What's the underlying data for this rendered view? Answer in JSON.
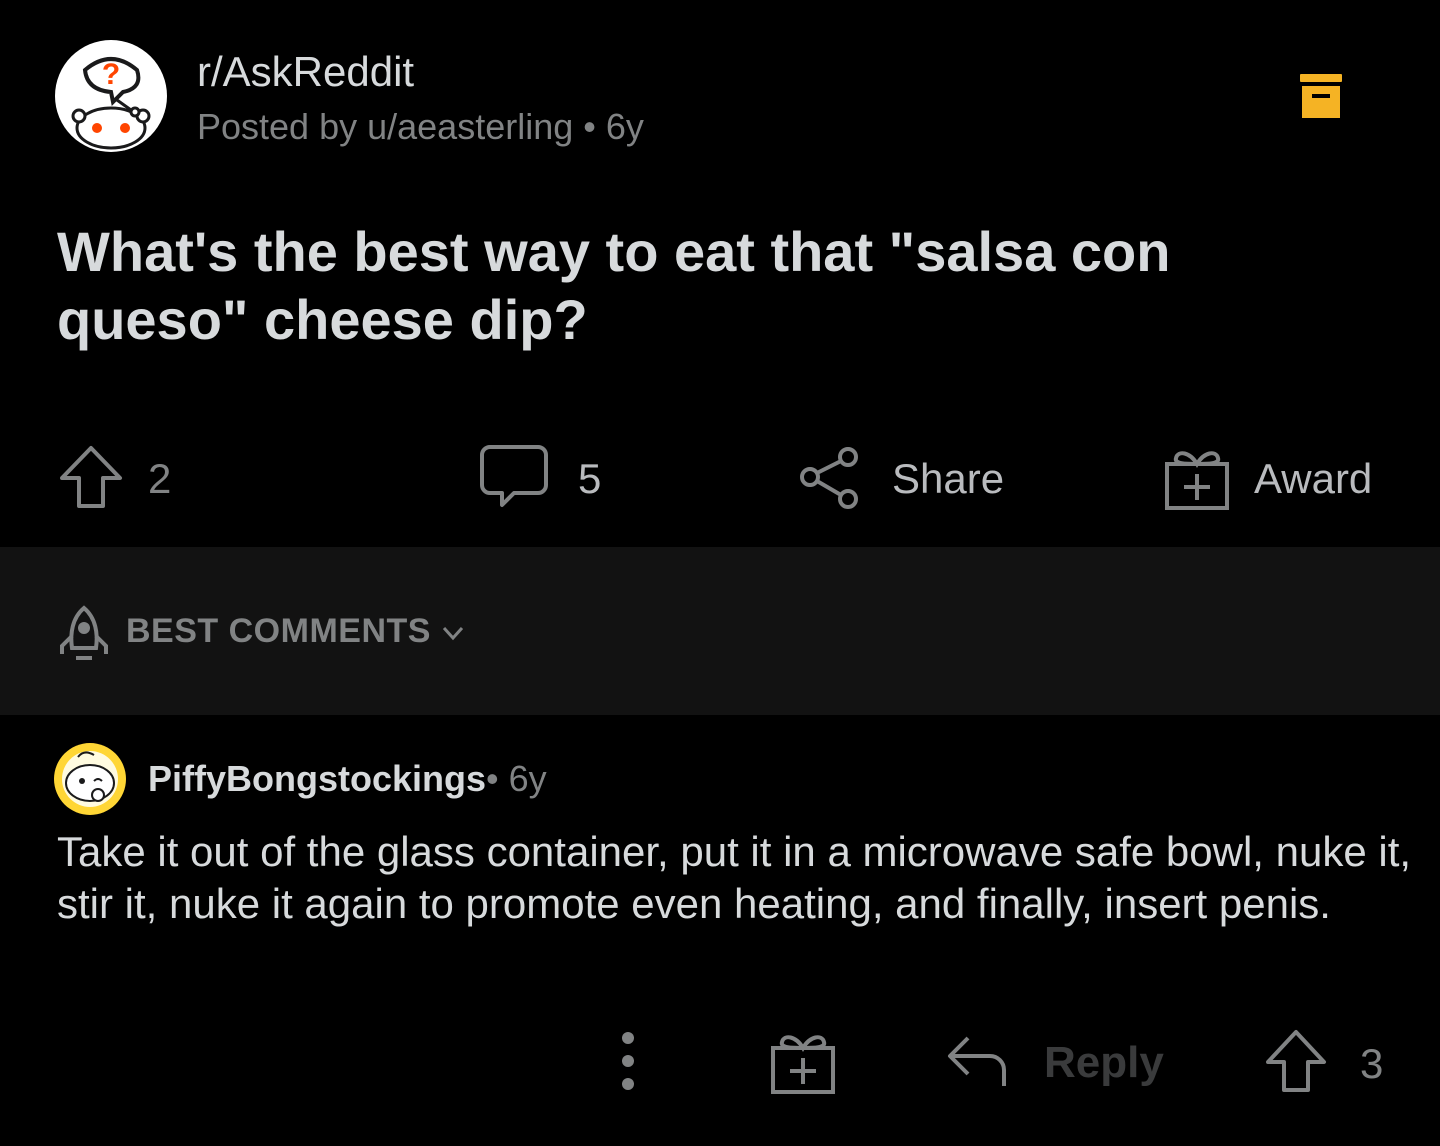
{
  "post": {
    "subreddit": "r/AskReddit",
    "posted_by": "Posted by u/aeasterling",
    "separator": "•",
    "age": "6y",
    "title": "What's the best way to eat that \"salsa con queso\" cheese dip?",
    "score": "2",
    "comments": "5",
    "share_label": "Share",
    "award_label": "Award"
  },
  "sort": {
    "label": "BEST COMMENTS"
  },
  "comment": {
    "author": "PiffyBongstockings",
    "separator": "•",
    "age": "6y",
    "body": "Take it out of the glass container, put it in a microwave safe bowl, nuke it, stir it, nuke it again to promote even heating, and finally, insert penis.",
    "reply_label": "Reply",
    "score": "3"
  },
  "colors": {
    "background": "#000000",
    "sort_bar": "#121212",
    "text": "#d7dadc",
    "muted": "#818384",
    "save_icon": "#f5b324"
  },
  "icons": [
    "subreddit-avatar",
    "save-icon",
    "upvote-icon",
    "comment-icon",
    "share-icon",
    "award-icon",
    "rocket-icon",
    "chevron-down-icon",
    "user-avatar",
    "more-icon",
    "reply-icon"
  ]
}
